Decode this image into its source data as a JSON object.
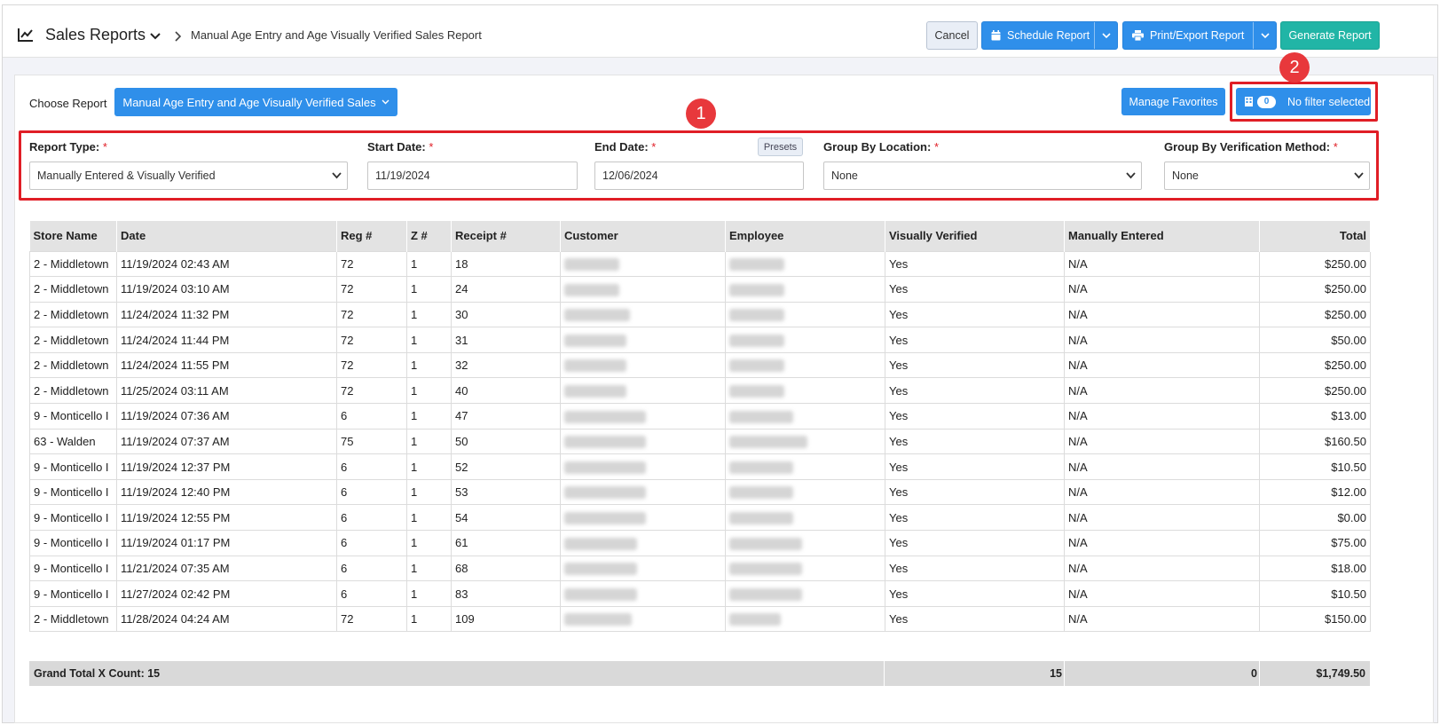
{
  "header": {
    "app_title": "Sales Reports",
    "breadcrumb": "Manual Age Entry and Age Visually Verified Sales Report",
    "cancel_label": "Cancel",
    "schedule_label": "Schedule Report",
    "print_label": "Print/Export Report",
    "generate_label": "Generate Report"
  },
  "choose": {
    "label": "Choose Report",
    "selected": "Manual Age Entry and Age Visually Verified Sales"
  },
  "actions": {
    "manage_favorites": "Manage Favorites",
    "filter_count": "0",
    "filter_label": "No filter selected"
  },
  "markers": {
    "one": "1",
    "two": "2"
  },
  "filters": {
    "report_type": {
      "label": "Report Type:",
      "value": "Manually Entered & Visually Verified"
    },
    "start_date": {
      "label": "Start Date:",
      "value": "11/19/2024"
    },
    "end_date": {
      "label": "End Date:",
      "value": "12/06/2024"
    },
    "presets": "Presets",
    "group_location": {
      "label": "Group By Location:",
      "value": "None"
    },
    "group_verification": {
      "label": "Group By Verification Method:",
      "value": "None"
    },
    "required_mark": "*"
  },
  "table": {
    "columns": [
      "Store Name",
      "Date",
      "Reg #",
      "Z #",
      "Receipt #",
      "Customer",
      "Employee",
      "Visually Verified",
      "Manually Entered",
      "Total"
    ],
    "rows": [
      {
        "store": "2 - Middletown",
        "date": "11/19/2024 02:43 AM",
        "reg": "72",
        "z": "1",
        "receipt": "18",
        "vv": "Yes",
        "me": "N/A",
        "total": "$250.00"
      },
      {
        "store": "2 - Middletown",
        "date": "11/19/2024 03:10 AM",
        "reg": "72",
        "z": "1",
        "receipt": "24",
        "vv": "Yes",
        "me": "N/A",
        "total": "$250.00"
      },
      {
        "store": "2 - Middletown",
        "date": "11/24/2024 11:32 PM",
        "reg": "72",
        "z": "1",
        "receipt": "30",
        "vv": "Yes",
        "me": "N/A",
        "total": "$250.00"
      },
      {
        "store": "2 - Middletown",
        "date": "11/24/2024 11:44 PM",
        "reg": "72",
        "z": "1",
        "receipt": "31",
        "vv": "Yes",
        "me": "N/A",
        "total": "$50.00"
      },
      {
        "store": "2 - Middletown",
        "date": "11/24/2024 11:55 PM",
        "reg": "72",
        "z": "1",
        "receipt": "32",
        "vv": "Yes",
        "me": "N/A",
        "total": "$250.00"
      },
      {
        "store": "2 - Middletown",
        "date": "11/25/2024 03:11 AM",
        "reg": "72",
        "z": "1",
        "receipt": "40",
        "vv": "Yes",
        "me": "N/A",
        "total": "$250.00"
      },
      {
        "store": "9 - Monticello I",
        "date": "11/19/2024 07:36 AM",
        "reg": "6",
        "z": "1",
        "receipt": "47",
        "vv": "Yes",
        "me": "N/A",
        "total": "$13.00"
      },
      {
        "store": "63 - Walden",
        "date": "11/19/2024 07:37 AM",
        "reg": "75",
        "z": "1",
        "receipt": "50",
        "vv": "Yes",
        "me": "N/A",
        "total": "$160.50"
      },
      {
        "store": "9 - Monticello I",
        "date": "11/19/2024 12:37 PM",
        "reg": "6",
        "z": "1",
        "receipt": "52",
        "vv": "Yes",
        "me": "N/A",
        "total": "$10.50"
      },
      {
        "store": "9 - Monticello I",
        "date": "11/19/2024 12:40 PM",
        "reg": "6",
        "z": "1",
        "receipt": "53",
        "vv": "Yes",
        "me": "N/A",
        "total": "$12.00"
      },
      {
        "store": "9 - Monticello I",
        "date": "11/19/2024 12:55 PM",
        "reg": "6",
        "z": "1",
        "receipt": "54",
        "vv": "Yes",
        "me": "N/A",
        "total": "$0.00"
      },
      {
        "store": "9 - Monticello I",
        "date": "11/19/2024 01:17 PM",
        "reg": "6",
        "z": "1",
        "receipt": "61",
        "vv": "Yes",
        "me": "N/A",
        "total": "$75.00"
      },
      {
        "store": "9 - Monticello I",
        "date": "11/21/2024 07:35 AM",
        "reg": "6",
        "z": "1",
        "receipt": "68",
        "vv": "Yes",
        "me": "N/A",
        "total": "$18.00"
      },
      {
        "store": "9 - Monticello I",
        "date": "11/27/2024 02:42 PM",
        "reg": "6",
        "z": "1",
        "receipt": "83",
        "vv": "Yes",
        "me": "N/A",
        "total": "$10.50"
      },
      {
        "store": "2 - Middletown",
        "date": "11/28/2024 04:24 AM",
        "reg": "72",
        "z": "1",
        "receipt": "109",
        "vv": "Yes",
        "me": "N/A",
        "total": "$150.00"
      }
    ]
  },
  "grand_total": {
    "label": "Grand Total X Count: 15",
    "visually_verified": "15",
    "manually_entered": "0",
    "total": "$1,749.50"
  },
  "colors": {
    "primary": "#2f8fea",
    "generate": "#21b5a6",
    "highlight": "#e01e26",
    "marker": "#e8383c",
    "link": "#2f8fd8"
  }
}
